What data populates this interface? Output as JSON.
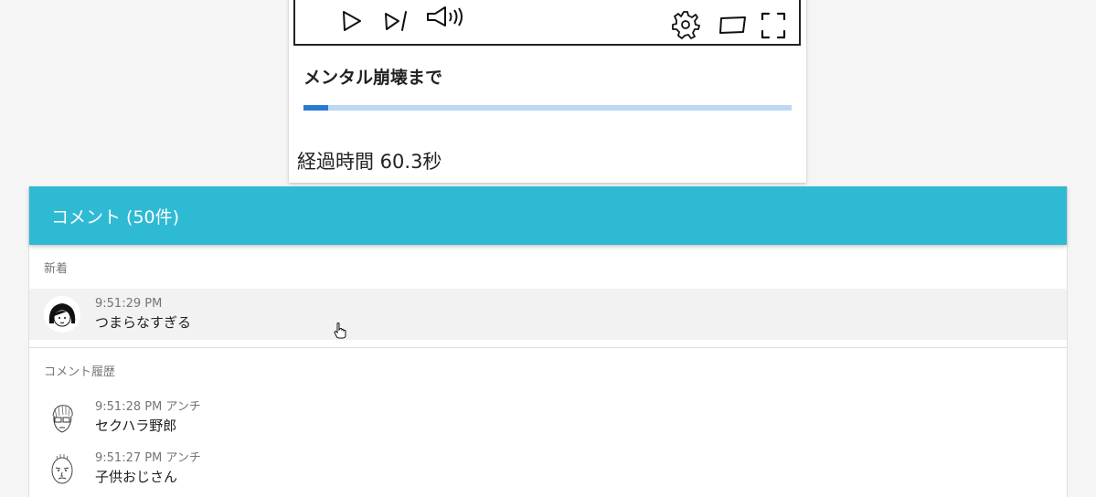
{
  "player": {
    "controls": [
      {
        "name": "play-icon"
      },
      {
        "name": "skip-icon"
      },
      {
        "name": "volume-icon"
      },
      {
        "name": "settings-gear-icon"
      },
      {
        "name": "theater-mode-icon"
      },
      {
        "name": "fullscreen-icon"
      }
    ],
    "title": "メンタル崩壊まで",
    "progress": 0.05,
    "elapsed_label": "経過時間 60.3秒",
    "accent_color": "#2b78d3",
    "track_color": "#bcd8f2"
  },
  "comments": {
    "header": "コメント (50件)",
    "header_color": "#2fbad4",
    "new_section": {
      "label": "新着",
      "items": [
        {
          "time": "9:51:29 PM",
          "text": "つまらなすぎる",
          "avatar": "avatar-girl-icon"
        }
      ]
    },
    "history_section": {
      "label": "コメント履歴",
      "items": [
        {
          "time": "9:51:28 PM アンチ",
          "text": "セクハラ野郎",
          "avatar": "avatar-glasses-man-icon"
        },
        {
          "time": "9:51:27 PM アンチ",
          "text": "子供おじさん",
          "avatar": "avatar-bald-man-icon"
        }
      ]
    }
  }
}
